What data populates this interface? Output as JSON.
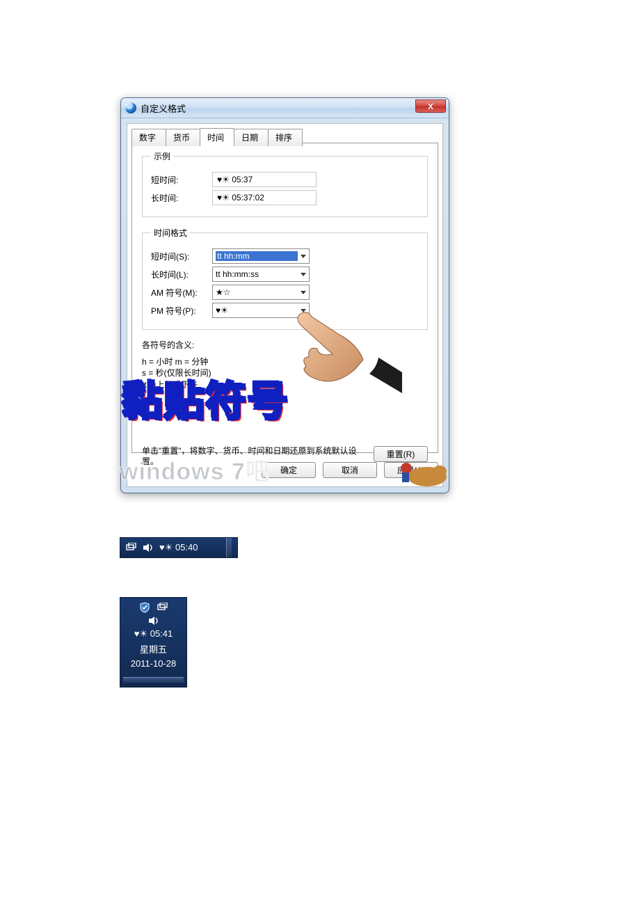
{
  "dialog": {
    "title": "自定义格式",
    "close_glyph": "X",
    "tabs": [
      "数字",
      "货币",
      "时间",
      "日期",
      "排序"
    ],
    "active_tab_index": 2,
    "example": {
      "legend": "示例",
      "short_label": "短时间:",
      "short_value": "♥☀ 05:37",
      "long_label": "长时间:",
      "long_value": "♥☀ 05:37:02"
    },
    "format": {
      "legend": "时间格式",
      "short_label": "短时间(S):",
      "short_value": "tt hh:mm",
      "long_label": "长时间(L):",
      "long_value": "tt hh:mm:ss",
      "am_label": "AM 符号(M):",
      "am_value": "★☆",
      "pm_label": "PM 符号(P):",
      "pm_value": "♥☀"
    },
    "meaning": {
      "title": "各符号的含义:",
      "line1": "h = 小时    m = 分钟",
      "line2": "s = 秒(仅限长时间)",
      "line3": "tt = 上午或下午"
    },
    "reset_text": "单击\"重置\"，将数字、货币、时间和日期还原到系统默认设置。",
    "reset_btn": "重置(R)",
    "ok_btn": "确定",
    "cancel_btn": "取消",
    "apply_btn": "应用(A)"
  },
  "overlay_text": "黏贴符号",
  "watermark": "windows 7吧",
  "taskbar1": {
    "time": "♥☀ 05:40"
  },
  "taskbar2": {
    "time": "♥☀ 05:41",
    "weekday": "星期五",
    "date": "2011-10-28"
  }
}
